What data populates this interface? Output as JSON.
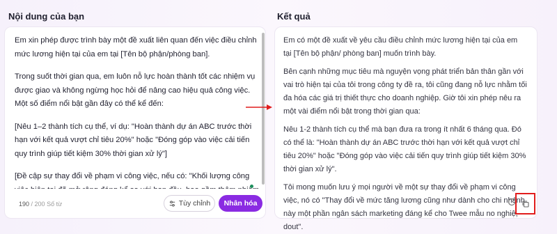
{
  "left": {
    "title": "Nội dung của bạn",
    "paragraphs": [
      "Em xin phép được trình bày một đề xuất liên quan đến việc điều chỉnh mức lương hiện tại của em tại [Tên bộ phận/phòng ban].",
      "Trong suốt thời gian qua, em luôn nỗ lực hoàn thành tốt các nhiệm vụ được giao và không ngừng học hỏi để nâng cao hiệu quả công việc. Một số điểm nổi bật gần đây có thể kể đến:",
      "[Nêu 1–2 thành tích cụ thể, ví dụ: \"Hoàn thành dự án ABC trước thời hạn với kết quả vượt chỉ tiêu 20%\" hoặc \"Đóng góp vào việc cải tiến quy trình giúp tiết kiệm 30% thời gian xử lý\"]",
      "[Đề cập sự thay đổi về phạm vi công việc, nếu có: \"Khối lượng công việc hiện tại đã mở rộng đáng kể so với ban đầu, bao gồm thêm nhiệm vụ...\"]"
    ],
    "counter_current": "190",
    "counter_max": "/ 200 Số từ",
    "btn_custom": "Tùy chỉnh",
    "btn_personalize": "Nhân hóa"
  },
  "right": {
    "title": "Kết quả",
    "paragraphs": [
      "Em có một đề xuất về yêu cầu điều chỉnh mức lương hiện tại của em tại [Tên bộ phận/ phòng ban] muốn trình bày.",
      "Bên cạnh những mục tiêu mà nguyện vọng phát triển bản thân gần với vai trò hiện tại của tôi trong công ty đề ra, tôi cũng đang nỗ lực nhằm tối đa hóa các giá trị thiết thực cho doanh nghiệp. Giờ tôi xin phép nêu ra một vài điểm nổi bật trong thời gian qua:",
      "Nêu 1-2 thành tích cụ thể mà bạn đưa ra trong ít nhất 6 tháng qua. Đó có thể là: \"Hoàn thành dự án ABC trước thời hạn với kết quả vượt chỉ tiêu 20%\" hoặc \"Đóng góp vào việc cải tiến quy trình giúp tiết kiệm 30% thời gian xử lý\".",
      "Tôi mong muốn lưu ý mọi người về một sự thay đổi về phạm vi công việc, nó có \"Thay đổi về mức tăng lương cũng như dành cho chi nhánh này một phần ngân sách marketing đáng kể cho Twee mẫu no nghiệ, dout\"."
    ]
  },
  "colors": {
    "accent": "#8a2be2",
    "highlight_box": "#e11d1d",
    "arrow": "#e11d1d"
  },
  "icons": {
    "custom": "sliders-icon",
    "refresh": "refresh-icon",
    "copy": "copy-icon",
    "arrow": "right-arrow-icon"
  }
}
